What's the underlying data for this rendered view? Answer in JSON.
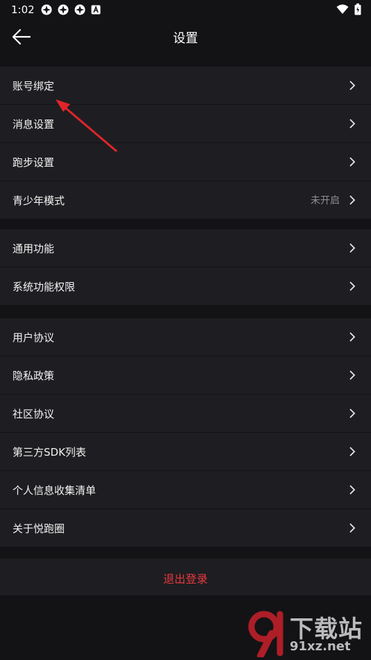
{
  "status_bar": {
    "time": "1:02"
  },
  "nav": {
    "title": "设置"
  },
  "groups": [
    {
      "items": [
        {
          "label": "账号绑定"
        },
        {
          "label": "消息设置"
        },
        {
          "label": "跑步设置"
        },
        {
          "label": "青少年模式",
          "value": "未开启"
        }
      ]
    },
    {
      "items": [
        {
          "label": "通用功能"
        },
        {
          "label": "系统功能权限"
        }
      ]
    },
    {
      "items": [
        {
          "label": "用户协议"
        },
        {
          "label": "隐私政策"
        },
        {
          "label": "社区协议"
        },
        {
          "label": "第三方SDK列表"
        },
        {
          "label": "个人信息收集清单"
        },
        {
          "label": "关于悦跑圈"
        }
      ]
    }
  ],
  "logout": {
    "label": "退出登录"
  },
  "watermark": {
    "top_text": "下载站",
    "bottom_text": "91xz.net"
  },
  "colors": {
    "background": "#131316",
    "row_bg": "#1e1e22",
    "logout_red": "#e8383d",
    "arrow_red": "#e0252a"
  }
}
